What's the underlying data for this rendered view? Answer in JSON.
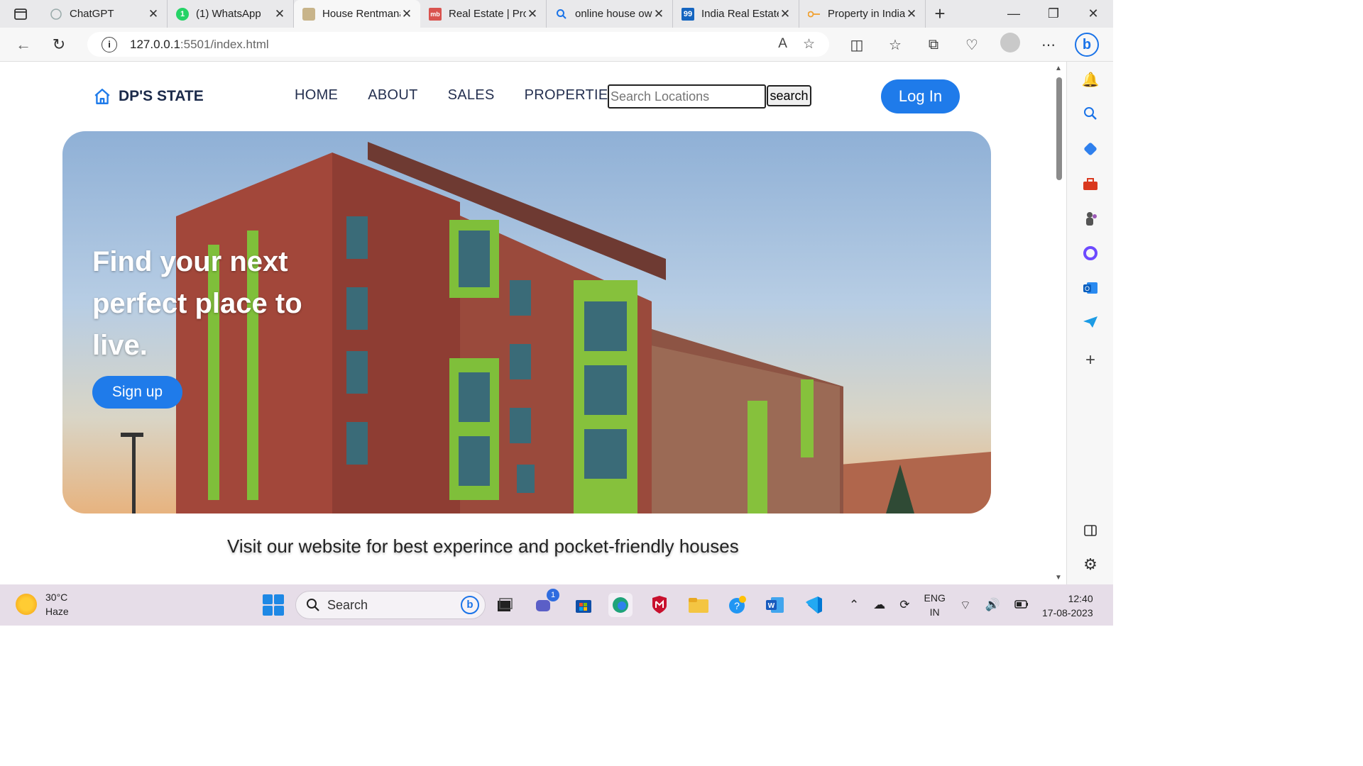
{
  "browser": {
    "tabs": [
      {
        "title": "ChatGPT",
        "favicon": "chatgpt-icon",
        "active": false
      },
      {
        "title": "(1) WhatsApp",
        "favicon": "whatsapp-icon",
        "active": false
      },
      {
        "title": "House Rentmanagement",
        "favicon": "house-icon",
        "active": true
      },
      {
        "title": "Real Estate | Property",
        "favicon": "magicbricks-icon",
        "active": false
      },
      {
        "title": "online house owner",
        "favicon": "search-icon",
        "active": false
      },
      {
        "title": "India Real Estate",
        "favicon": "99acres-icon",
        "active": false
      },
      {
        "title": "Property in India",
        "favicon": "key-icon",
        "active": false
      }
    ],
    "url_host": "127.0.0.1",
    "url_path": ":5501/index.html"
  },
  "site": {
    "brand": "DP'S STATE",
    "nav": [
      "HOME",
      "ABOUT",
      "SALES",
      "PROPERTIES"
    ],
    "search_placeholder": "Search Locations",
    "search_button": "search",
    "login": "Log In",
    "hero_heading": "Find your next perfect place to live.",
    "signup": "Sign up",
    "tagline": "Visit our website for best experince and pocket-friendly houses"
  },
  "taskbar": {
    "temperature": "30°C",
    "weather": "Haze",
    "search_label": "Search",
    "chat_badge": "1",
    "language": "ENG",
    "region": "IN",
    "time": "12:40",
    "date": "17-08-2023"
  },
  "colors": {
    "primary_button": "#1f7bea",
    "brand_text": "#1b2a4a",
    "nav_text": "#253050"
  }
}
